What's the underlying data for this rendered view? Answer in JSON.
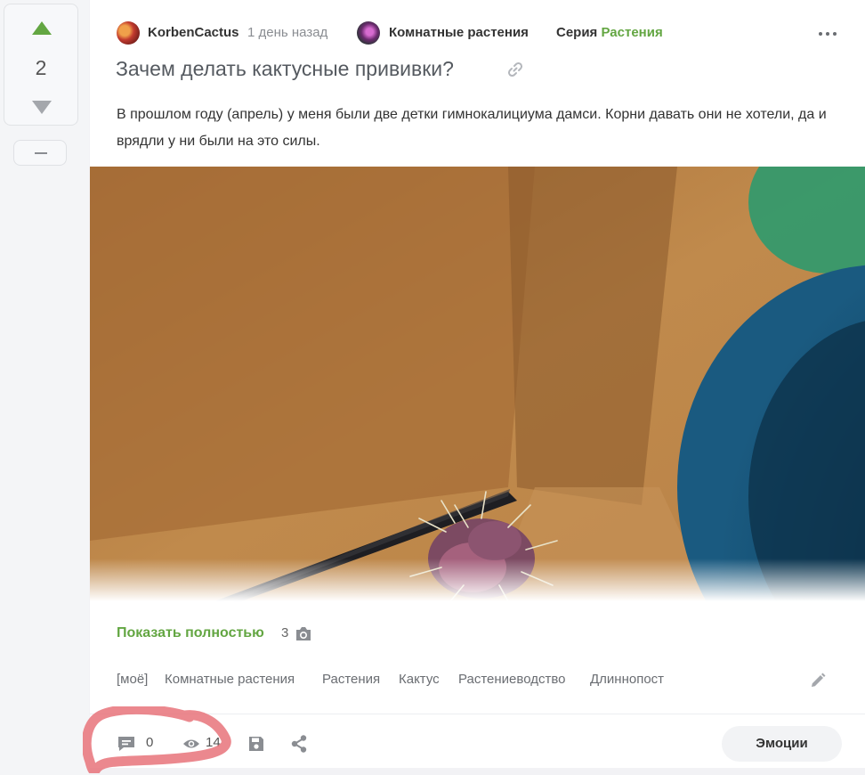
{
  "rating": {
    "count": "2"
  },
  "header": {
    "author": "KorbenCactus",
    "time": "1 день назад",
    "community": "Комнатные растения",
    "series_label": "Серия",
    "series_name": "Растения"
  },
  "title": "Зачем делать кактусные прививки?",
  "body": "В прошлом году (апрель) у меня были две детки гимнокалициума дамси. Корни давать они не хотели, да и врядли у ни были на это силы.",
  "show_more": {
    "label": "Показать полностью",
    "count": "3"
  },
  "tags": [
    "[моё]",
    "Комнатные растения",
    "Растения",
    "Кактус",
    "Растениеводство",
    "Длиннопост"
  ],
  "footer": {
    "comments": "0",
    "views": "14",
    "emotions_label": "Эмоции"
  },
  "colors": {
    "accent": "#63a642",
    "annotation": "#e8737a",
    "text": "#333333",
    "muted": "#8a8d92"
  },
  "icons": [
    "upvote-icon",
    "downvote-icon",
    "collapse-icon",
    "more-icon",
    "link-icon",
    "camera-icon",
    "edit-icon",
    "comments-icon",
    "views-icon",
    "save-icon",
    "share-icon"
  ]
}
